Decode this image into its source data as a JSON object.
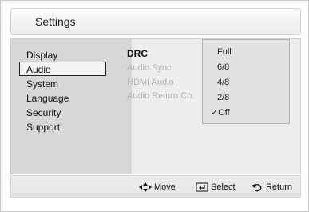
{
  "title": "Settings",
  "sidebar": {
    "items": [
      {
        "label": "Display"
      },
      {
        "label": "Audio",
        "selected": true
      },
      {
        "label": "System"
      },
      {
        "label": "Language"
      },
      {
        "label": "Security"
      },
      {
        "label": "Support"
      }
    ]
  },
  "audio_options": [
    {
      "label": "DRC",
      "active": true
    },
    {
      "label": "Audio Sync"
    },
    {
      "label": "HDMI Audio"
    },
    {
      "label": "Audio Return Ch."
    }
  ],
  "dropdown": {
    "items": [
      {
        "label": "Full"
      },
      {
        "label": "6/8"
      },
      {
        "label": "4/8"
      },
      {
        "label": "2/8"
      },
      {
        "label": "Off",
        "checked": true
      }
    ],
    "check_mark": "✓"
  },
  "footer": {
    "move_label": "Move",
    "select_label": "Select",
    "return_label": "Return",
    "move_icon": "dpad-arrows-icon",
    "select_icon": "enter-key-icon",
    "return_icon": "return-arrow-icon"
  }
}
